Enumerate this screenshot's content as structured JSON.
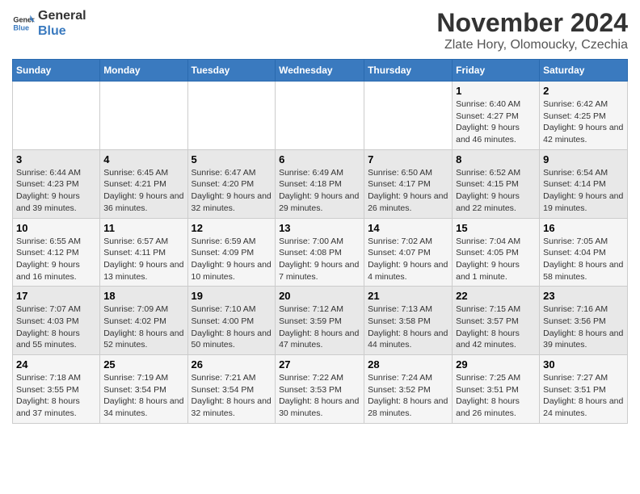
{
  "logo": {
    "line1": "General",
    "line2": "Blue"
  },
  "title": "November 2024",
  "subtitle": "Zlate Hory, Olomoucky, Czechia",
  "weekdays": [
    "Sunday",
    "Monday",
    "Tuesday",
    "Wednesday",
    "Thursday",
    "Friday",
    "Saturday"
  ],
  "weeks": [
    [
      {
        "day": "",
        "info": ""
      },
      {
        "day": "",
        "info": ""
      },
      {
        "day": "",
        "info": ""
      },
      {
        "day": "",
        "info": ""
      },
      {
        "day": "",
        "info": ""
      },
      {
        "day": "1",
        "info": "Sunrise: 6:40 AM\nSunset: 4:27 PM\nDaylight: 9 hours and 46 minutes."
      },
      {
        "day": "2",
        "info": "Sunrise: 6:42 AM\nSunset: 4:25 PM\nDaylight: 9 hours and 42 minutes."
      }
    ],
    [
      {
        "day": "3",
        "info": "Sunrise: 6:44 AM\nSunset: 4:23 PM\nDaylight: 9 hours and 39 minutes."
      },
      {
        "day": "4",
        "info": "Sunrise: 6:45 AM\nSunset: 4:21 PM\nDaylight: 9 hours and 36 minutes."
      },
      {
        "day": "5",
        "info": "Sunrise: 6:47 AM\nSunset: 4:20 PM\nDaylight: 9 hours and 32 minutes."
      },
      {
        "day": "6",
        "info": "Sunrise: 6:49 AM\nSunset: 4:18 PM\nDaylight: 9 hours and 29 minutes."
      },
      {
        "day": "7",
        "info": "Sunrise: 6:50 AM\nSunset: 4:17 PM\nDaylight: 9 hours and 26 minutes."
      },
      {
        "day": "8",
        "info": "Sunrise: 6:52 AM\nSunset: 4:15 PM\nDaylight: 9 hours and 22 minutes."
      },
      {
        "day": "9",
        "info": "Sunrise: 6:54 AM\nSunset: 4:14 PM\nDaylight: 9 hours and 19 minutes."
      }
    ],
    [
      {
        "day": "10",
        "info": "Sunrise: 6:55 AM\nSunset: 4:12 PM\nDaylight: 9 hours and 16 minutes."
      },
      {
        "day": "11",
        "info": "Sunrise: 6:57 AM\nSunset: 4:11 PM\nDaylight: 9 hours and 13 minutes."
      },
      {
        "day": "12",
        "info": "Sunrise: 6:59 AM\nSunset: 4:09 PM\nDaylight: 9 hours and 10 minutes."
      },
      {
        "day": "13",
        "info": "Sunrise: 7:00 AM\nSunset: 4:08 PM\nDaylight: 9 hours and 7 minutes."
      },
      {
        "day": "14",
        "info": "Sunrise: 7:02 AM\nSunset: 4:07 PM\nDaylight: 9 hours and 4 minutes."
      },
      {
        "day": "15",
        "info": "Sunrise: 7:04 AM\nSunset: 4:05 PM\nDaylight: 9 hours and 1 minute."
      },
      {
        "day": "16",
        "info": "Sunrise: 7:05 AM\nSunset: 4:04 PM\nDaylight: 8 hours and 58 minutes."
      }
    ],
    [
      {
        "day": "17",
        "info": "Sunrise: 7:07 AM\nSunset: 4:03 PM\nDaylight: 8 hours and 55 minutes."
      },
      {
        "day": "18",
        "info": "Sunrise: 7:09 AM\nSunset: 4:02 PM\nDaylight: 8 hours and 52 minutes."
      },
      {
        "day": "19",
        "info": "Sunrise: 7:10 AM\nSunset: 4:00 PM\nDaylight: 8 hours and 50 minutes."
      },
      {
        "day": "20",
        "info": "Sunrise: 7:12 AM\nSunset: 3:59 PM\nDaylight: 8 hours and 47 minutes."
      },
      {
        "day": "21",
        "info": "Sunrise: 7:13 AM\nSunset: 3:58 PM\nDaylight: 8 hours and 44 minutes."
      },
      {
        "day": "22",
        "info": "Sunrise: 7:15 AM\nSunset: 3:57 PM\nDaylight: 8 hours and 42 minutes."
      },
      {
        "day": "23",
        "info": "Sunrise: 7:16 AM\nSunset: 3:56 PM\nDaylight: 8 hours and 39 minutes."
      }
    ],
    [
      {
        "day": "24",
        "info": "Sunrise: 7:18 AM\nSunset: 3:55 PM\nDaylight: 8 hours and 37 minutes."
      },
      {
        "day": "25",
        "info": "Sunrise: 7:19 AM\nSunset: 3:54 PM\nDaylight: 8 hours and 34 minutes."
      },
      {
        "day": "26",
        "info": "Sunrise: 7:21 AM\nSunset: 3:54 PM\nDaylight: 8 hours and 32 minutes."
      },
      {
        "day": "27",
        "info": "Sunrise: 7:22 AM\nSunset: 3:53 PM\nDaylight: 8 hours and 30 minutes."
      },
      {
        "day": "28",
        "info": "Sunrise: 7:24 AM\nSunset: 3:52 PM\nDaylight: 8 hours and 28 minutes."
      },
      {
        "day": "29",
        "info": "Sunrise: 7:25 AM\nSunset: 3:51 PM\nDaylight: 8 hours and 26 minutes."
      },
      {
        "day": "30",
        "info": "Sunrise: 7:27 AM\nSunset: 3:51 PM\nDaylight: 8 hours and 24 minutes."
      }
    ]
  ]
}
